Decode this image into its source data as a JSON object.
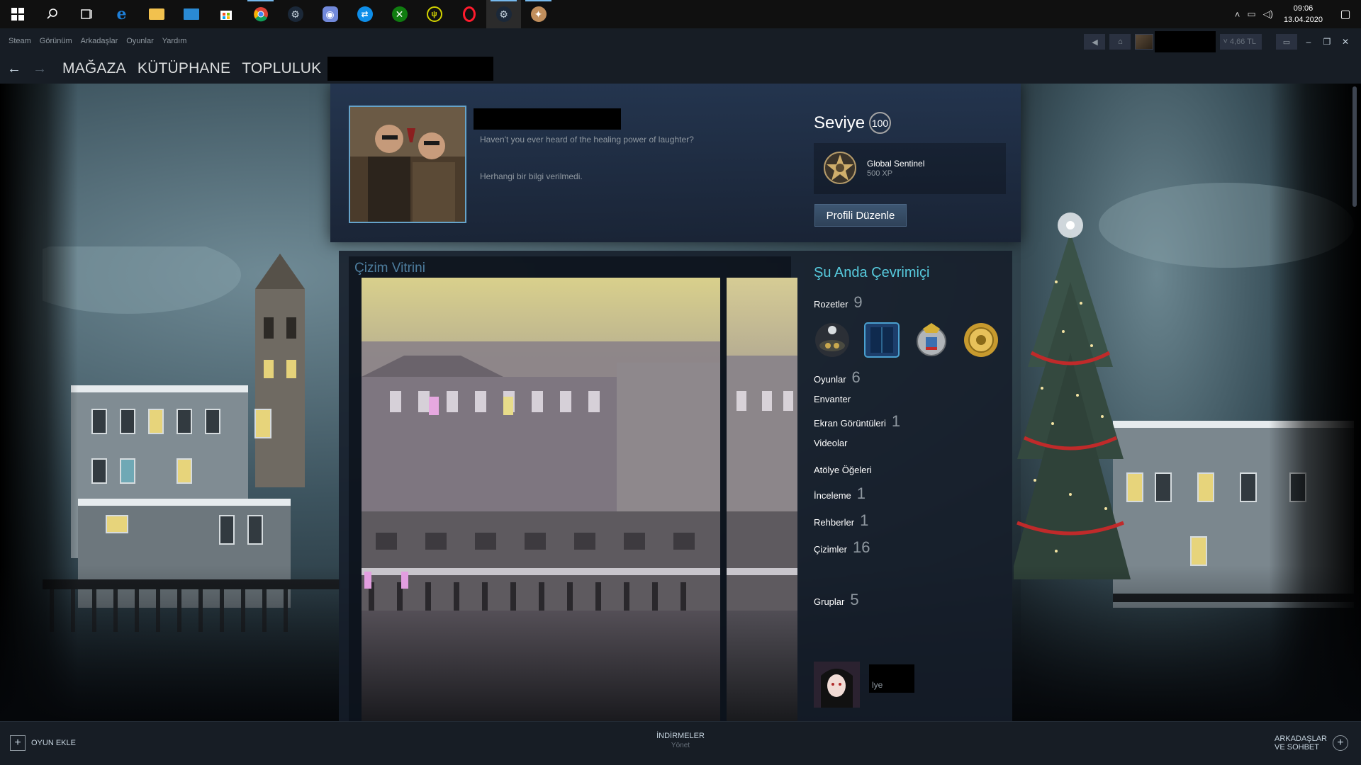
{
  "taskbar": {
    "clock_time": "09:06",
    "clock_date": "13.04.2020",
    "apps": [
      "windows-start",
      "search",
      "task-view",
      "edge",
      "file-explorer",
      "mail",
      "store",
      "chrome",
      "steam",
      "discord",
      "teamviewer",
      "xbox",
      "overwolf",
      "opera",
      "steam-active",
      "game-app"
    ]
  },
  "steam_menu": {
    "items": [
      "Steam",
      "Görünüm",
      "Arkadaşlar",
      "Oyunlar",
      "Yardım"
    ],
    "wallet": "4,66 TL"
  },
  "nav": {
    "store": "MAĞAZA",
    "library": "KÜTÜPHANE",
    "community": "TOPLULUK"
  },
  "profile": {
    "quote": "Haven't you ever heard of the healing power of laughter?",
    "no_info": "Herhangi bir bilgi verilmedi.",
    "level_label": "Seviye",
    "level": "100",
    "badge_name": "Global Sentinel",
    "badge_xp": "500 XP",
    "edit_button": "Profili Düzenle"
  },
  "showcase": {
    "title": "Çizim Vitrini"
  },
  "sidebar": {
    "status": "Şu Anda Çevrimiçi",
    "badges_label": "Rozetler",
    "badges_count": "9",
    "stats": [
      {
        "label": "Oyunlar",
        "count": "6"
      },
      {
        "label": "Envanter",
        "count": ""
      },
      {
        "label": "Ekran Görüntüleri",
        "count": "1"
      },
      {
        "label": "Videolar",
        "count": ""
      },
      {
        "label": "Atölye Öğeleri",
        "count": ""
      },
      {
        "label": "İnceleme",
        "count": "1"
      },
      {
        "label": "Rehberler",
        "count": "1"
      },
      {
        "label": "Çizimler",
        "count": "16"
      }
    ],
    "groups_label": "Gruplar",
    "groups_count": "5",
    "group_name_suffix": "lye"
  },
  "bottombar": {
    "add_game": "OYUN EKLE",
    "downloads": "İNDİRMELER",
    "downloads_sub": "Yönet",
    "friends_line1": "ARKADAŞLAR",
    "friends_line2": "VE SOHBET"
  },
  "colors": {
    "steam_dark": "#171d25",
    "accent_online": "#57cbde",
    "text_muted": "#8f98a0",
    "showcase_title": "#4d7d9e"
  }
}
